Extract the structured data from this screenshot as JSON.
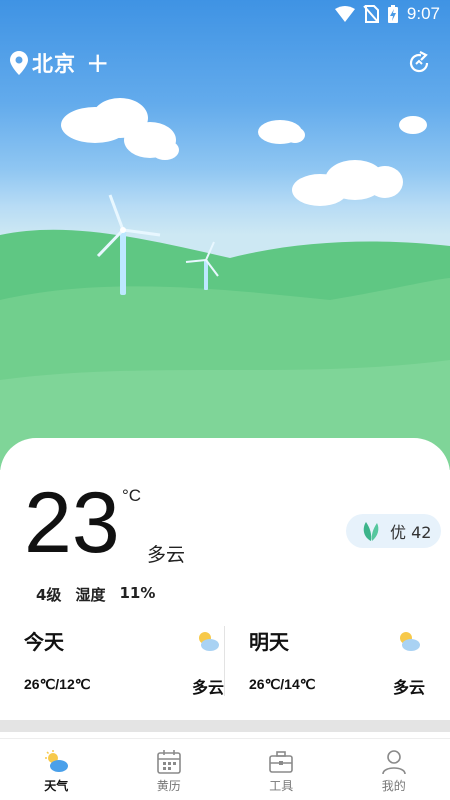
{
  "status_bar": {
    "time": "9:07",
    "icons": [
      "wifi-icon",
      "no-sim-icon",
      "battery-charging-icon"
    ]
  },
  "header": {
    "city": "北京",
    "add_label": "+",
    "icons": [
      "location-pin-icon",
      "refresh-icon"
    ]
  },
  "current": {
    "temperature": "23",
    "unit": "°C",
    "condition": "多云",
    "aqi_label": "优",
    "aqi_value": "42",
    "wind": "4级",
    "humidity_label": "湿度",
    "humidity_value": "11%"
  },
  "forecast": [
    {
      "title": "今天",
      "range": "26℃/12℃",
      "condition": "多云",
      "icon": "partly-cloudy-icon"
    },
    {
      "title": "明天",
      "range": "26℃/14℃",
      "condition": "多云",
      "icon": "partly-cloudy-icon"
    }
  ],
  "tabs": [
    {
      "label": "天气",
      "icon": "weather-icon",
      "active": true
    },
    {
      "label": "黄历",
      "icon": "calendar-icon",
      "active": false
    },
    {
      "label": "工具",
      "icon": "toolbox-icon",
      "active": false
    },
    {
      "label": "我的",
      "icon": "profile-icon",
      "active": false
    }
  ],
  "colors": {
    "sky": "#5aa6ea",
    "hills": "#5cc47f",
    "aqi_badge": "#e7f2fb",
    "leaf": "#3cb48a"
  }
}
